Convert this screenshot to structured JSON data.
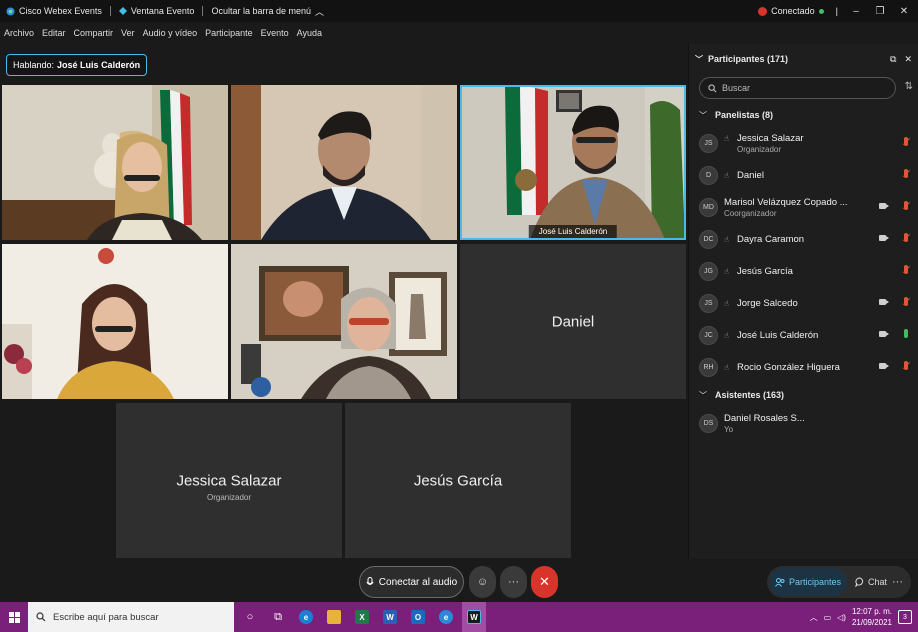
{
  "titlebar": {
    "app_name": "Cisco Webex Events",
    "window_label": "Ventana Evento",
    "hide_menu": "Ocultar la barra de menú",
    "status": "Conectado",
    "minimize": "–",
    "restore": "❐",
    "close": "✕"
  },
  "menu": [
    "Archivo",
    "Editar",
    "Compartir",
    "Ver",
    "Audio y vídeo",
    "Participante",
    "Evento",
    "Ayuda"
  ],
  "speaking": {
    "prefix": "Hablando:",
    "name": "José Luis Calderón"
  },
  "tiles": {
    "t3_label": "José Luis Calderón",
    "daniel": "Daniel",
    "jessica": "Jessica Salazar",
    "jessica_role": "Organizador",
    "jesus": "Jesús García"
  },
  "panel": {
    "title": "Participantes (171)",
    "search_placeholder": "Buscar",
    "panelists_header": "Panelistas (8)",
    "attendees_header": "Asistentes (163)",
    "panelists": [
      {
        "initials": "JS",
        "name": "Jessica Salazar",
        "role": "Organizador"
      },
      {
        "initials": "D",
        "name": "Daniel",
        "role": ""
      },
      {
        "initials": "MD",
        "name": "Marisol Velázquez Copado ...",
        "role": "Coorganizador"
      },
      {
        "initials": "DC",
        "name": "Dayra Caramon",
        "role": ""
      },
      {
        "initials": "JG",
        "name": "Jesús García",
        "role": ""
      },
      {
        "initials": "JS",
        "name": "Jorge Salcedo",
        "role": ""
      },
      {
        "initials": "JC",
        "name": "José Luis Calderón",
        "role": ""
      },
      {
        "initials": "RH",
        "name": "Rocio González Higuera",
        "role": ""
      }
    ],
    "attendees": [
      {
        "initials": "DS",
        "name": "Daniel Rosales S...",
        "role": "Yo"
      }
    ]
  },
  "controls": {
    "audio": "Conectar al audio",
    "reactions": "☺",
    "more": "···",
    "end": "✕",
    "participants": "Participantes",
    "chat": "Chat"
  },
  "taskbar": {
    "search_placeholder": "Escribe aquí para buscar",
    "time": "12:07 p. m.",
    "date": "21/09/2021",
    "notifications": "3"
  },
  "colors": {
    "accent": "#49b9e5",
    "end_call": "#d9342b",
    "taskbar": "#7a1f7a"
  }
}
